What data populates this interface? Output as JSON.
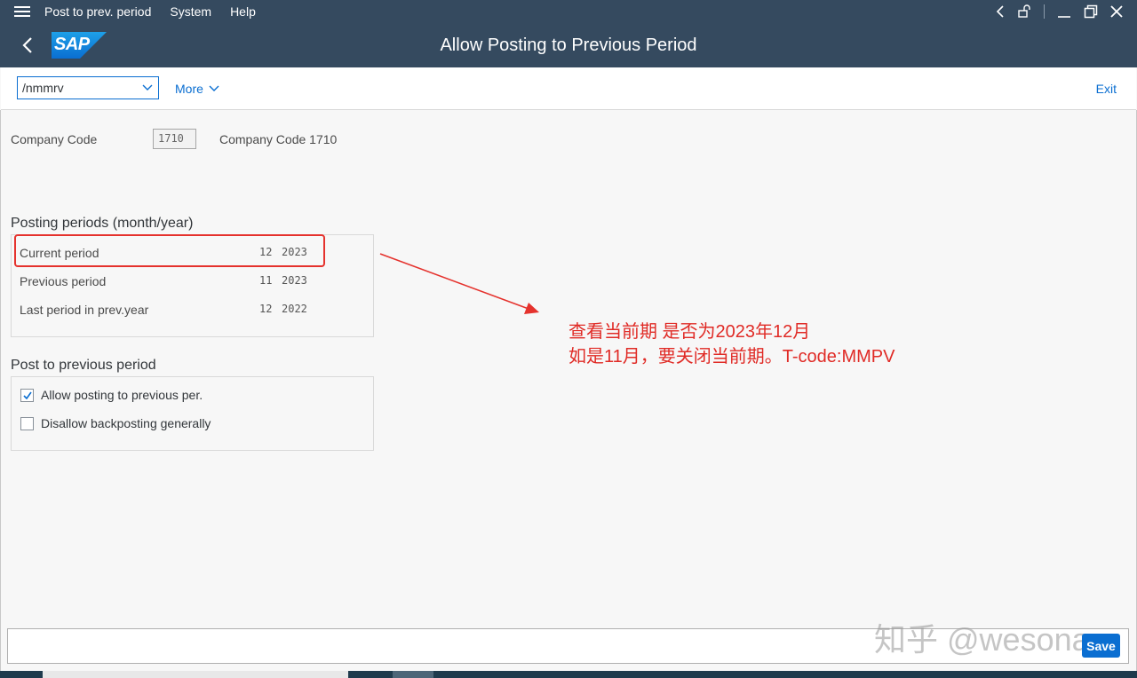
{
  "menu": {
    "items": [
      {
        "label": "Post to prev. period"
      },
      {
        "label": "System"
      },
      {
        "label": "Help"
      }
    ]
  },
  "header": {
    "logo_text": "SAP",
    "title": "Allow Posting to Previous Period"
  },
  "toolbar": {
    "command_value": "/nmmrv",
    "more_label": "More",
    "exit_label": "Exit"
  },
  "company": {
    "label": "Company Code",
    "value": "1710",
    "description": "Company Code 1710"
  },
  "posting_periods": {
    "title": "Posting periods (month/year)",
    "rows": [
      {
        "label": "Current period",
        "month": "12",
        "year": "2023"
      },
      {
        "label": "Previous period",
        "month": "11",
        "year": "2023"
      },
      {
        "label": "Last period in prev.year",
        "month": "12",
        "year": "2022"
      }
    ]
  },
  "post_previous": {
    "title": "Post to previous period",
    "options": [
      {
        "label": "Allow posting to previous per.",
        "checked": true
      },
      {
        "label": "Disallow backposting generally",
        "checked": false
      }
    ]
  },
  "annotation": {
    "line1": "查看当前期 是否为2023年12月",
    "line2": "如是11月，要关闭当前期。T-code:MMPV",
    "color": "#e02b26"
  },
  "statusbar": {
    "save_label": "Save"
  },
  "watermark": "知乎 @wesona",
  "colors": {
    "shell": "#354a5f",
    "accent": "#0a6ed1",
    "highlight": "#e5322d"
  }
}
